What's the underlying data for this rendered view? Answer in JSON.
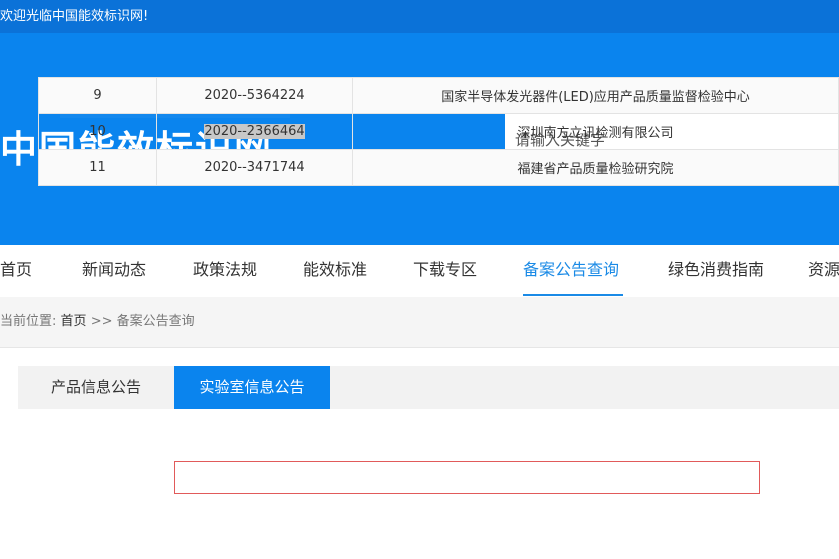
{
  "topbar": {
    "welcome": "欢迎光临中国能效标识网!"
  },
  "header": {
    "site_title": "中国能效标识网",
    "search_placeholder": "请输入关键字"
  },
  "nav": {
    "items": [
      "首页",
      "新闻动态",
      "政策法规",
      "能效标准",
      "下载专区",
      "备案公告查询",
      "绿色消费指南",
      "资源"
    ],
    "active": "备案公告查询"
  },
  "breadcrumb": {
    "prefix": "当前位置:",
    "home": "首页",
    "separator": ">>",
    "current": "备案公告查询"
  },
  "tabs": [
    "产品信息公告",
    "实验室信息公告"
  ],
  "table": {
    "rows": [
      {
        "no": "9",
        "code": "2020--5364224",
        "org": "国家半导体发光器件(LED)应用产品质量监督检验中心"
      },
      {
        "no": "10",
        "code": "2020--2366464",
        "org": "深圳南方立讯检测有限公司"
      },
      {
        "no": "11",
        "code": "2020--3471744",
        "org": "福建省产品质量检验研究院"
      }
    ]
  },
  "colors": {
    "primary": "#0a84ee",
    "topbar": "#0b72d8",
    "highlight_border": "#e15a5a"
  }
}
